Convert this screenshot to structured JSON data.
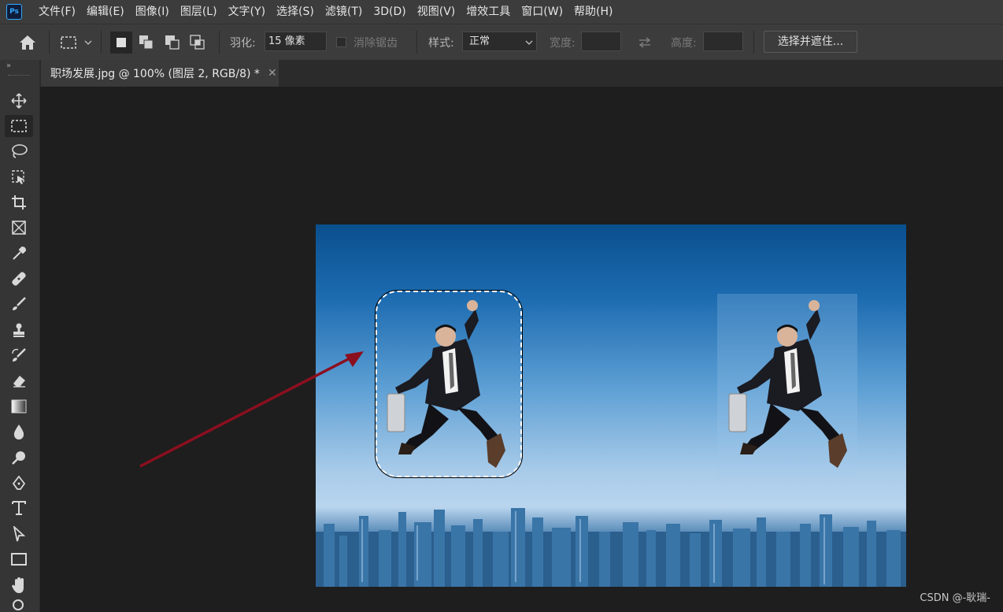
{
  "app": {
    "logo": "Ps"
  },
  "menu": [
    "文件(F)",
    "编辑(E)",
    "图像(I)",
    "图层(L)",
    "文字(Y)",
    "选择(S)",
    "滤镜(T)",
    "3D(D)",
    "视图(V)",
    "增效工具",
    "窗口(W)",
    "帮助(H)"
  ],
  "options": {
    "feather_label": "羽化:",
    "feather_value": "15 像素",
    "antialias_label": "消除锯齿",
    "style_label": "样式:",
    "style_value": "正常",
    "width_label": "宽度:",
    "height_label": "高度:",
    "select_mask_button": "选择并遮住..."
  },
  "document": {
    "tab_title": "职场发展.jpg @ 100% (图层 2, RGB/8) *"
  },
  "tools": [
    "move-tool",
    "marquee-tool",
    "lasso-tool",
    "object-selection-tool",
    "crop-tool",
    "frame-tool",
    "eyedropper-tool",
    "healing-brush-tool",
    "brush-tool",
    "clone-stamp-tool",
    "history-brush-tool",
    "eraser-tool",
    "gradient-tool",
    "blur-tool",
    "dodge-tool",
    "pen-tool",
    "type-tool",
    "path-selection-tool",
    "rectangle-tool",
    "hand-tool",
    "zoom-tool"
  ],
  "annotation": {
    "arrow_color": "#8b0f1f"
  },
  "watermark": "CSDN @-耿瑞-"
}
